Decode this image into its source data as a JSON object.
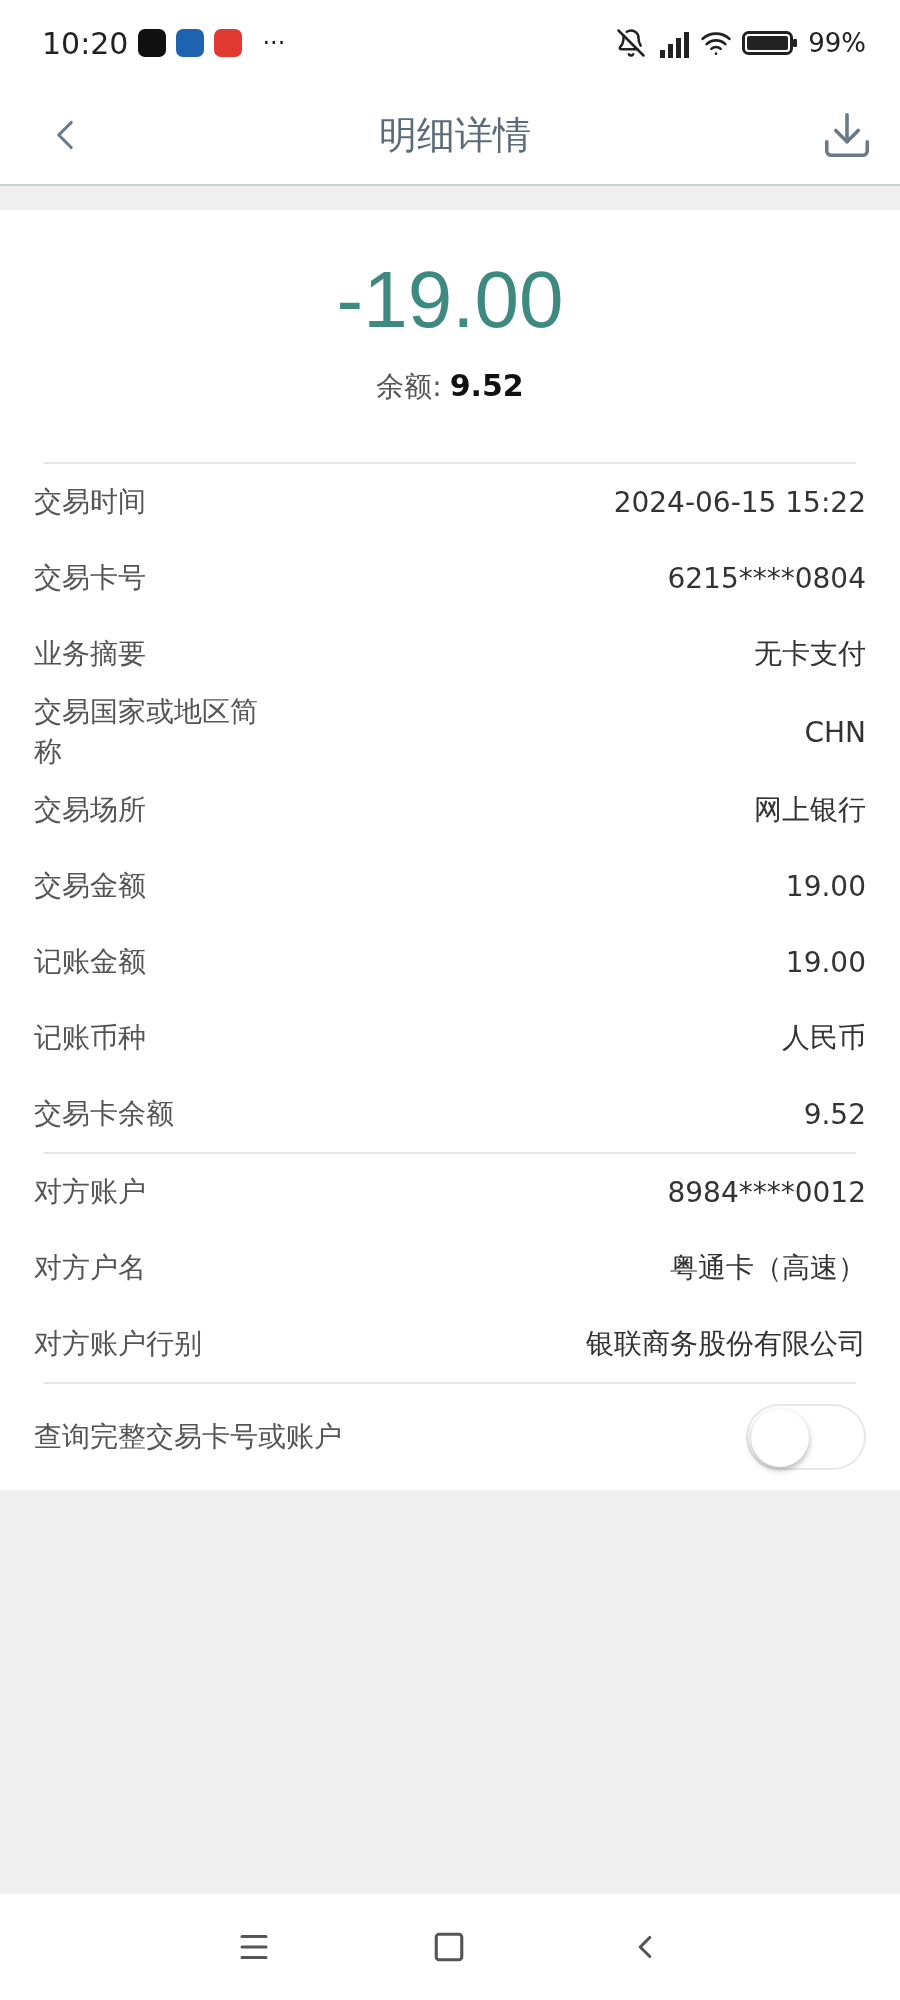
{
  "status_bar": {
    "time": "10:20",
    "more": "···",
    "battery": "99%"
  },
  "header": {
    "title": "明细详情"
  },
  "summary": {
    "amount": "-19.00",
    "balance_label": "余额:",
    "balance_value": "9.52"
  },
  "sections": [
    [
      {
        "label": "交易时间",
        "value": "2024-06-15 15:22"
      },
      {
        "label": "交易卡号",
        "value": "6215****0804"
      },
      {
        "label": "业务摘要",
        "value": "无卡支付"
      },
      {
        "label": "交易国家或地区简称",
        "value": "CHN"
      },
      {
        "label": "交易场所",
        "value": "网上银行"
      },
      {
        "label": "交易金额",
        "value": "19.00"
      },
      {
        "label": "记账金额",
        "value": "19.00"
      },
      {
        "label": "记账币种",
        "value": "人民币"
      },
      {
        "label": "交易卡余额",
        "value": "9.52"
      }
    ],
    [
      {
        "label": "对方账户",
        "value": "8984****0012"
      },
      {
        "label": "对方户名",
        "value": "粤通卡（高速）"
      },
      {
        "label": "对方账户行别",
        "value": "银联商务股份有限公司"
      }
    ]
  ],
  "toggle": {
    "label": "查询完整交易卡号或账户",
    "on": false
  }
}
